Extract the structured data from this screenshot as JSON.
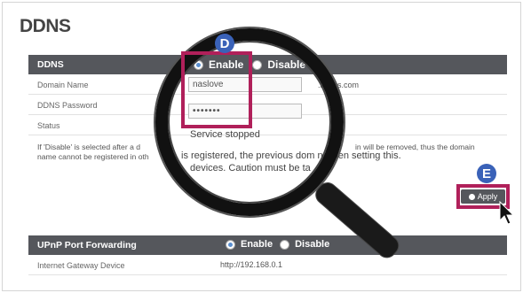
{
  "page_title": "DDNS",
  "ddns_section": {
    "header": "DDNS",
    "enable_label": "Enable",
    "disable_label": "Disable",
    "selected": "Enable"
  },
  "fields": {
    "domain_name_label": "Domain Name",
    "domain_name_value": "naslove",
    "domain_suffix_visible": ".lgna  s.com",
    "password_label": "DDNS Password",
    "password_value": "•••••••",
    "status_label": "Status",
    "status_value": "Service stopped"
  },
  "note": {
    "line1_left": "If 'Disable' is selected after a d",
    "line1_right": "in will be removed, thus the domain",
    "line2_left": "name cannot be registered in oth",
    "magnified_line1": "is registered, the previous dom  n when setting this.",
    "magnified_line2": "devices. Caution must be ta"
  },
  "apply_label": "Apply",
  "callouts": {
    "d": "D",
    "e": "E"
  },
  "upnp_section": {
    "header": "UPnP Port Forwarding",
    "enable_label": "Enable",
    "disable_label": "Disable",
    "selected": "Enable",
    "gateway_label": "Internet Gateway Device",
    "gateway_value": "http://192.168.0.1"
  },
  "colors": {
    "header_bar": "#55575c",
    "highlight": "#b0205a",
    "badge": "#3a62b8",
    "radio_on": "#5a8fd0"
  }
}
